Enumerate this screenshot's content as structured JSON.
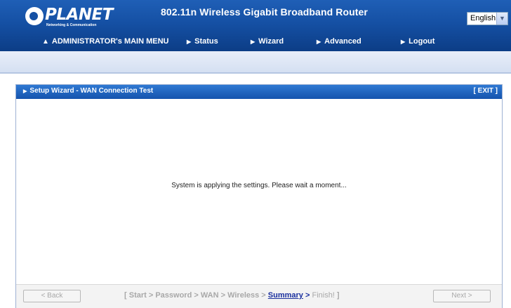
{
  "header": {
    "brand": "PLANET",
    "tagline": "Networking & Communication",
    "product_title": "802.11n Wireless Gigabit Broadband Router",
    "language": {
      "selected": "English"
    }
  },
  "nav": {
    "items": [
      {
        "label": "ADMINISTRATOR's MAIN MENU",
        "icon": "person-icon"
      },
      {
        "label": "Status",
        "icon": "arrow-right-icon"
      },
      {
        "label": "Wizard",
        "icon": "arrow-right-icon"
      },
      {
        "label": "Advanced",
        "icon": "arrow-right-icon"
      },
      {
        "label": "Logout",
        "icon": "arrow-right-icon"
      }
    ]
  },
  "panel": {
    "title": "Setup Wizard - WAN Connection Test",
    "exit_label": "[ EXIT ]",
    "message": "System is applying the settings. Please wait a moment..."
  },
  "footer": {
    "back_label": "< Back",
    "next_label": "Next >",
    "steps": {
      "open": "[ ",
      "step1": "Start",
      "step2": "Password",
      "step3": "WAN",
      "step4": "Wireless",
      "current": "Summary",
      "final": "Finish!",
      "close": " ]",
      "sep": " > "
    }
  },
  "colors": {
    "header_blue": "#1550a4",
    "panel_header_blue": "#1f66c2",
    "current_step": "#1a2f9e",
    "disabled_text": "#a8a8a8"
  }
}
